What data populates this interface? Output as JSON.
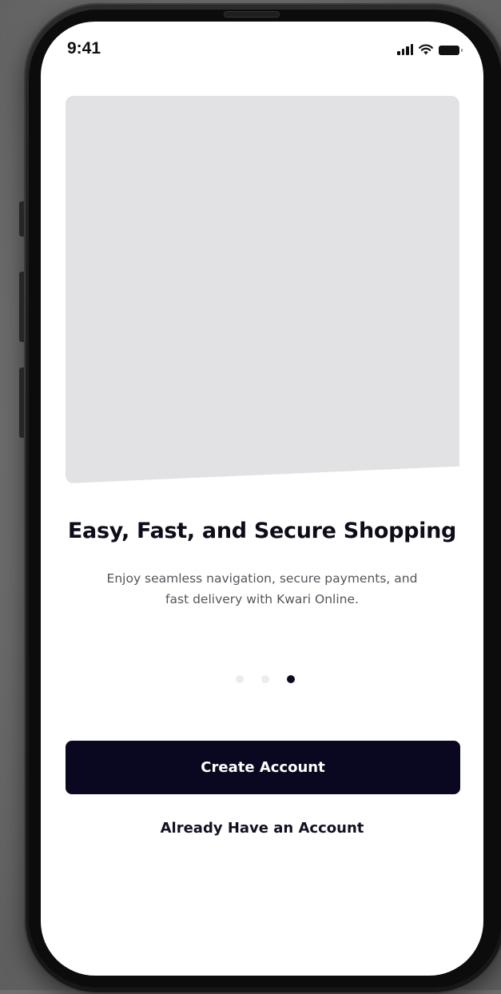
{
  "status_bar": {
    "time": "9:41",
    "icons": [
      "signal-icon",
      "wifi-icon",
      "battery-icon"
    ]
  },
  "onboarding": {
    "title": "Easy, Fast, and Secure Shopping",
    "description_line1": "Enjoy seamless navigation, secure payments, and",
    "description_line2": "fast delivery with Kwari Online.",
    "pagination": {
      "total": 3,
      "active_index": 2
    }
  },
  "actions": {
    "primary_label": "Create Account",
    "secondary_label": "Already Have an Account"
  },
  "colors": {
    "primary_button": "#0a0820",
    "image_placeholder": "#e2e2e4",
    "dot_inactive": "#ececee",
    "dot_active": "#0a0a1e"
  }
}
